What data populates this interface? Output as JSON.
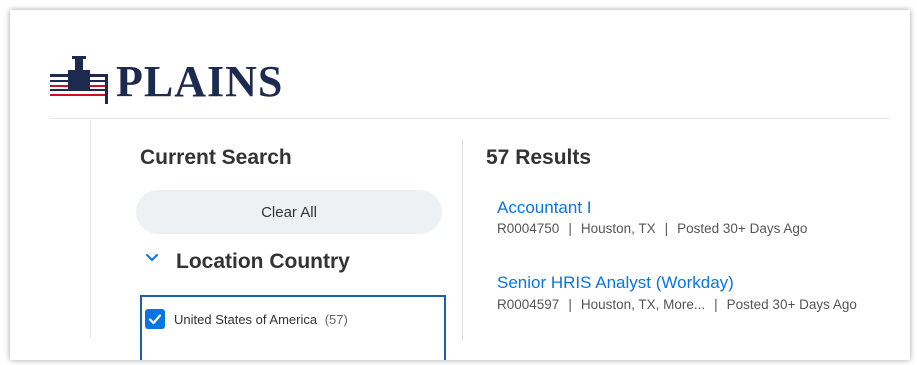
{
  "brand": {
    "name": "PLAINS",
    "colors": {
      "navy": "#1b2a4e",
      "red": "#c8102e",
      "link": "#0875e1"
    }
  },
  "filters": {
    "heading": "Current Search",
    "clear_all_label": "Clear All",
    "location_country": {
      "title": "Location Country",
      "expanded": true,
      "options": [
        {
          "label": "United States of America",
          "count": "(57)",
          "checked": true
        }
      ]
    }
  },
  "results": {
    "count_label": "57 Results",
    "jobs": [
      {
        "title": "Accountant I",
        "req_id": "R0004750",
        "location": "Houston, TX",
        "posted": "Posted 30+ Days Ago"
      },
      {
        "title": "Senior HRIS Analyst (Workday)",
        "req_id": "R0004597",
        "location": "Houston, TX, More...",
        "posted": "Posted 30+ Days Ago"
      }
    ],
    "separator": "|"
  }
}
